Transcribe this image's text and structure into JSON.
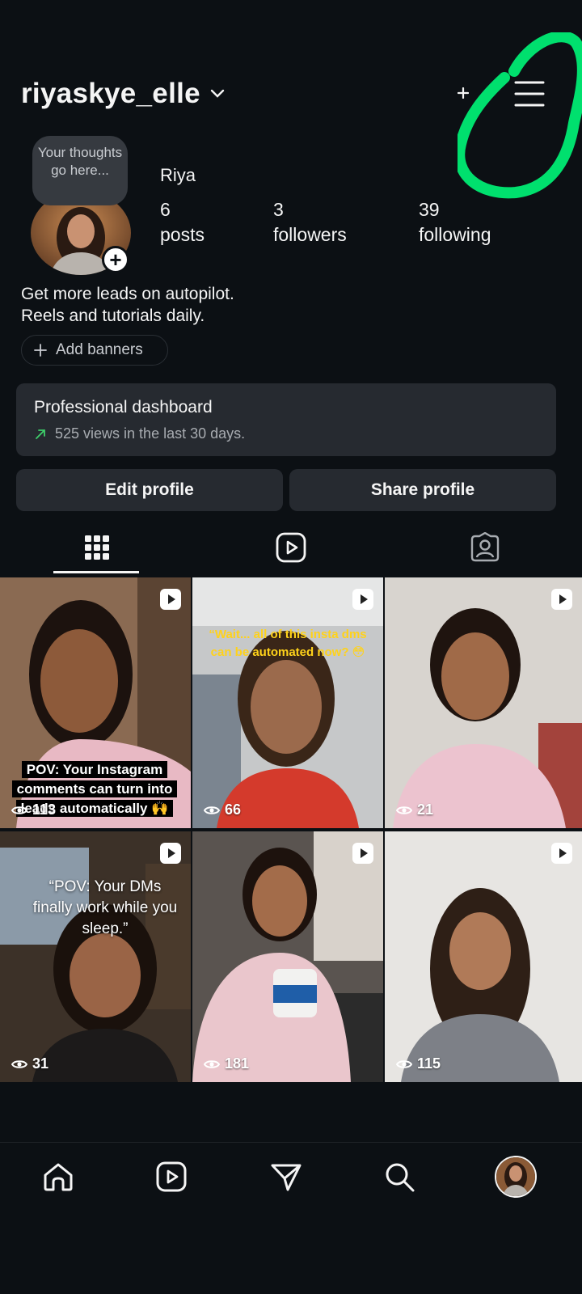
{
  "profile": {
    "username": "riyaskye_elle",
    "display_name": "Riya",
    "note_placeholder": "Your thoughts go here...",
    "stats": [
      {
        "number": "6",
        "label": "posts"
      },
      {
        "number": "3",
        "label": "followers"
      },
      {
        "number": "39",
        "label": "following"
      }
    ],
    "bio_line1": "Get more leads on autopilot.",
    "bio_line2": "Reels and tutorials daily.",
    "add_banners_label": "Add banners"
  },
  "dashboard": {
    "title": "Professional dashboard",
    "subtitle": "525 views in the last 30 days."
  },
  "buttons": {
    "edit_profile": "Edit profile",
    "share_profile": "Share profile"
  },
  "tabs": [
    {
      "icon": "grid-icon"
    },
    {
      "icon": "reels-icon"
    },
    {
      "icon": "tagged-icon"
    }
  ],
  "posts": [
    {
      "views": "113",
      "caption": "POV: Your Instagram comments can turn into leads automatically 🙌"
    },
    {
      "views": "66",
      "caption": "“Wait... all of this insta dms can be automated now? 😳"
    },
    {
      "views": "21",
      "caption": ""
    },
    {
      "views": "31",
      "caption": "“POV: Your DMs finally work while you sleep.”"
    },
    {
      "views": "181",
      "caption": ""
    },
    {
      "views": "115",
      "caption": ""
    }
  ],
  "colors": {
    "background": "#0c1014",
    "card": "#262a30",
    "highlight": "#00e06e",
    "accent_green": "#3ecf6a"
  },
  "nav": [
    "home-icon",
    "reels-icon",
    "messages-icon",
    "search-icon",
    "profile-avatar"
  ]
}
